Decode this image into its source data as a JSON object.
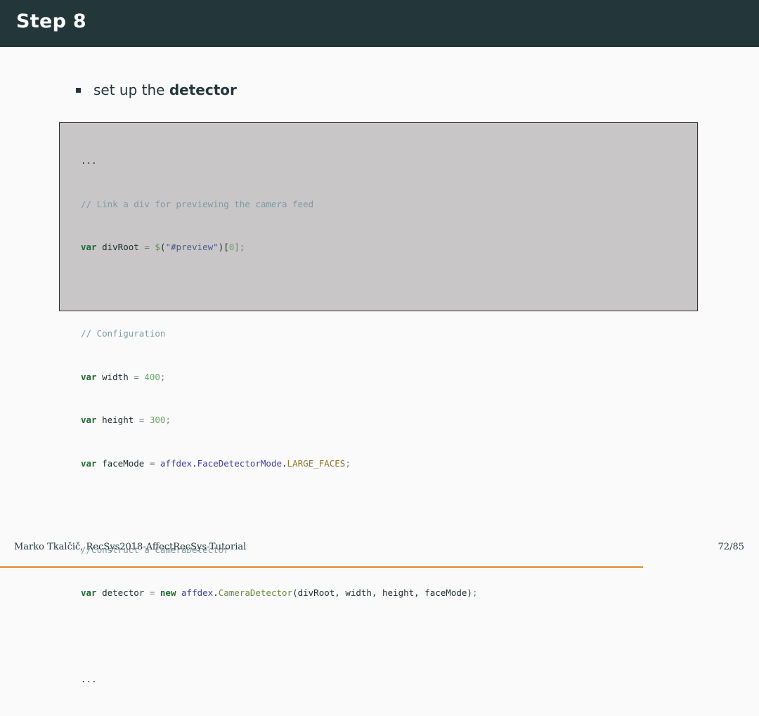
{
  "slide": {
    "title": "Step 8",
    "bullet": {
      "text": "set up the ",
      "bold": "detector"
    }
  },
  "code": {
    "line1": "...",
    "line2": "// Link a div for previewing the camera feed",
    "line3": {
      "kw": "var",
      "name": " divRoot ",
      "eq": "= ",
      "fn": "$",
      "p1": "(",
      "str": "\"#preview\"",
      "p2": ")[",
      "num": "0",
      "p3": "];"
    },
    "line5": "// Configuration",
    "line6": {
      "kw": "var",
      "name": " width ",
      "eq": "= ",
      "num": "400",
      "semi": ";"
    },
    "line7": {
      "kw": "var",
      "name": " height ",
      "eq": "= ",
      "num": "300",
      "semi": ";"
    },
    "line8": {
      "kw": "var",
      "name": " faceMode ",
      "eq": "= ",
      "obj": "affdex",
      "dot1": ".",
      "cls": "FaceDetectorMode",
      "dot2": ".",
      "const": "LARGE_FACES",
      "semi": ";"
    },
    "line10": "//Construct a CameraDetector",
    "line11": {
      "kw": "var",
      "name": " detector ",
      "eq": "= ",
      "kw2": "new",
      "sp": " ",
      "obj": "affdex",
      "dot": ".",
      "fn": "CameraDetector",
      "args": "(divRoot, width, height, faceMode)",
      "semi": ";"
    },
    "line13": "..."
  },
  "footer": {
    "left": "Marko Tkalčič, RecSys2018-AffectRecSys-Tutorial",
    "page": "72/85"
  },
  "progress": {
    "fraction": 0.847
  },
  "colors": {
    "titlebar": "#23373b",
    "progress": "#e38a2c",
    "codebg": "#c8c6c7"
  }
}
